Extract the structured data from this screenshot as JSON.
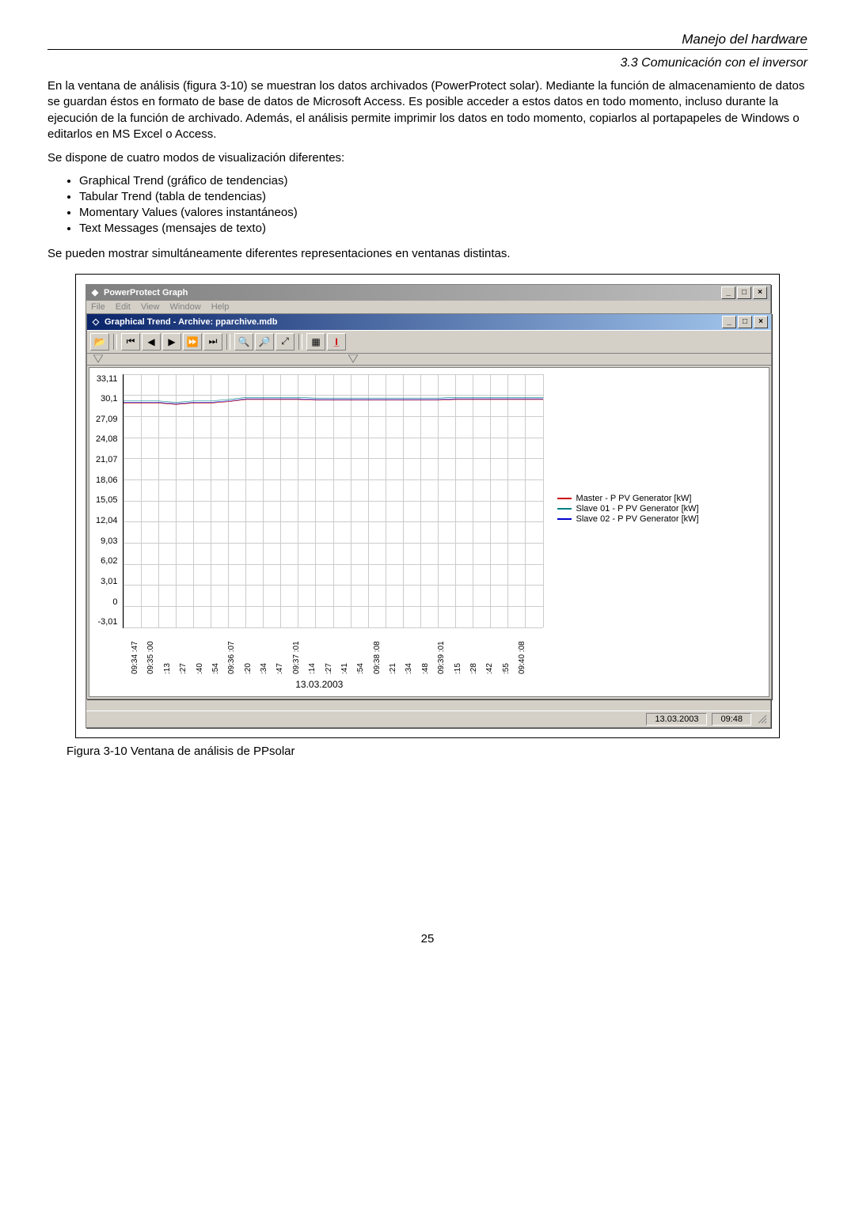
{
  "header": {
    "title1": "Manejo del hardware",
    "title2": "3.3 Comunicación con el inversor"
  },
  "para1": "En la ventana de análisis (figura 3-10) se muestran los datos archivados (PowerProtect solar). Mediante la función de almacenamiento de datos se guardan éstos en formato de base de datos de Microsoft Access. Es posible acceder a estos datos en todo momento, incluso durante la ejecución de la función de archivado. Además, el análisis permite imprimir los datos en todo momento, copiarlos al portapapeles de Windows o editarlos en MS Excel o Access.",
  "para2": "Se dispone de cuatro modos de visualización diferentes:",
  "list": [
    "Graphical Trend (gráfico de tendencias)",
    "Tabular Trend (tabla de tendencias)",
    "Momentary Values (valores instantáneos)",
    "Text Messages (mensajes de texto)"
  ],
  "para3": "Se pueden mostrar simultáneamente diferentes representaciones en ventanas distintas.",
  "caption": "Figura 3-10 Ventana de análisis de PPsolar",
  "page_num": "25",
  "outer_window": {
    "title": "PowerProtect Graph",
    "menu": [
      "File",
      "Edit",
      "View",
      "Window",
      "Help"
    ]
  },
  "inner_window": {
    "title": "Graphical Trend - Archive: pparchive.mdb"
  },
  "toolbar_icons": {
    "open": "open-icon",
    "first": "first-icon",
    "prev": "prev-icon",
    "play": "play-icon",
    "next": "next-icon",
    "last": "last-icon",
    "zoomin": "zoomin-icon",
    "zoomout": "zoomout-icon",
    "zoomfit": "zoomfit-icon",
    "grid": "grid-icon",
    "config": "config-icon"
  },
  "statusbar": {
    "date": "13.03.2003",
    "time": "09:48"
  },
  "legend_items": [
    {
      "color": "#cc0000",
      "label": "Master - P PV Generator [kW]"
    },
    {
      "color": "#008080",
      "label": "Slave 01 - P PV Generator [kW]"
    },
    {
      "color": "#0000cc",
      "label": "Slave 02 - P PV Generator [kW]"
    }
  ],
  "chart_data": {
    "type": "line",
    "title": "",
    "xlabel": "",
    "ylabel": "",
    "ylim": [
      -3.01,
      33.11
    ],
    "x_date": "13.03.2003",
    "y_ticks": [
      "33,11",
      "30,1",
      "27,09",
      "24,08",
      "21,07",
      "18,06",
      "15,05",
      "12,04",
      "9,03",
      "6,02",
      "3,01",
      "0",
      "-3,01"
    ],
    "x_ticks": [
      "09:34 :47",
      "09:35 :00",
      ":13",
      ":27",
      ":40",
      ":54",
      "09:36 :07",
      ":20",
      ":34",
      ":47",
      "09:37 :01",
      ":14",
      ":27",
      ":41",
      ":54",
      "09:38 :08",
      ":21",
      ":34",
      ":48",
      "09:39 :01",
      ":15",
      ":28",
      ":42",
      ":55",
      "09:40 :08"
    ],
    "series": [
      {
        "name": "Master - P PV Generator [kW]",
        "color": "#cc0000",
        "values": [
          29,
          29,
          29,
          28.8,
          29,
          29,
          29.2,
          29.5,
          29.5,
          29.5,
          29.5,
          29.4,
          29.4,
          29.4,
          29.4,
          29.4,
          29.4,
          29.4,
          29.4,
          29.5,
          29.5,
          29.5,
          29.5,
          29.5,
          29.5
        ]
      },
      {
        "name": "Slave 01 - P PV Generator [kW]",
        "color": "#008080",
        "values": [
          29.3,
          29.3,
          29.3,
          29.1,
          29.3,
          29.3,
          29.5,
          29.8,
          29.8,
          29.8,
          29.8,
          29.7,
          29.7,
          29.7,
          29.7,
          29.7,
          29.7,
          29.7,
          29.7,
          29.8,
          29.8,
          29.8,
          29.8,
          29.8,
          29.8
        ]
      },
      {
        "name": "Slave 02 - P PV Generator [kW]",
        "color": "#0000cc",
        "values": [
          29.1,
          29.1,
          29.1,
          28.9,
          29.1,
          29.1,
          29.3,
          29.6,
          29.6,
          29.6,
          29.6,
          29.5,
          29.5,
          29.5,
          29.5,
          29.5,
          29.5,
          29.5,
          29.5,
          29.6,
          29.6,
          29.6,
          29.6,
          29.6,
          29.6
        ]
      }
    ]
  }
}
